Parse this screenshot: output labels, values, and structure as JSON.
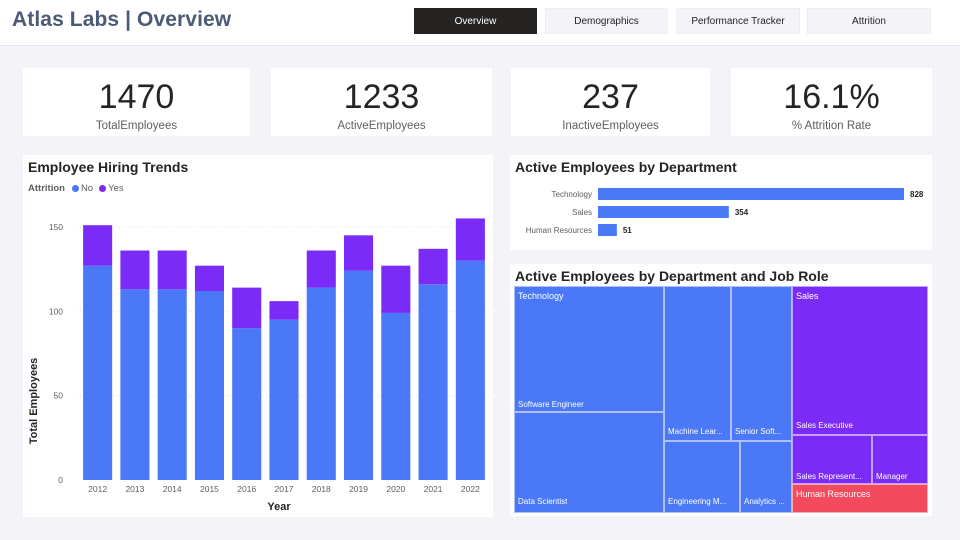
{
  "header": {
    "title": "Atlas Labs | Overview",
    "nav": [
      {
        "label": "Overview",
        "active": true
      },
      {
        "label": "Demographics",
        "active": false
      },
      {
        "label": "Performance Tracker",
        "active": false
      },
      {
        "label": "Attrition",
        "active": false
      }
    ]
  },
  "kpis": [
    {
      "value": "1470",
      "label": "TotalEmployees"
    },
    {
      "value": "1233",
      "label": "ActiveEmployees"
    },
    {
      "value": "237",
      "label": "InactiveEmployees"
    },
    {
      "value": "16.1%",
      "label": "% Attrition Rate"
    }
  ],
  "colors": {
    "no": "#4a78f6",
    "yes": "#7b2bf7",
    "hr": "#f24b5e",
    "grid": "#e3e3e3"
  },
  "hiring": {
    "title": "Employee Hiring Trends",
    "legend_title": "Attrition",
    "legend": [
      "No",
      "Yes"
    ]
  },
  "chart_data": [
    {
      "type": "bar",
      "stacked": true,
      "title": "Employee Hiring Trends",
      "xlabel": "Year",
      "ylabel": "Total Employees",
      "categories": [
        "2012",
        "2013",
        "2014",
        "2015",
        "2016",
        "2017",
        "2018",
        "2019",
        "2020",
        "2021",
        "2022"
      ],
      "series": [
        {
          "name": "No",
          "values": [
            127,
            113,
            113,
            112,
            90,
            95,
            114,
            124,
            99,
            116,
            130
          ]
        },
        {
          "name": "Yes",
          "values": [
            24,
            23,
            23,
            15,
            24,
            11,
            22,
            21,
            28,
            21,
            25
          ]
        }
      ],
      "ylim": [
        0,
        160
      ],
      "yticks": [
        0,
        50,
        100,
        150
      ],
      "grid": true,
      "legend_position": "top-left"
    },
    {
      "type": "bar",
      "orientation": "horizontal",
      "title": "Active Employees by Department",
      "categories": [
        "Technology",
        "Sales",
        "Human Resources"
      ],
      "values": [
        828,
        354,
        51
      ]
    }
  ],
  "treemap": {
    "title": "Active Employees by Department and Job Role",
    "departments": [
      "Technology",
      "Sales",
      "Human Resources"
    ],
    "roles": [
      "Software Engineer",
      "Data Scientist",
      "Machine Lear...",
      "Senior Soft...",
      "Engineering M...",
      "Analytics ...",
      "Sales Executive",
      "Sales Represent...",
      "Manager"
    ]
  }
}
